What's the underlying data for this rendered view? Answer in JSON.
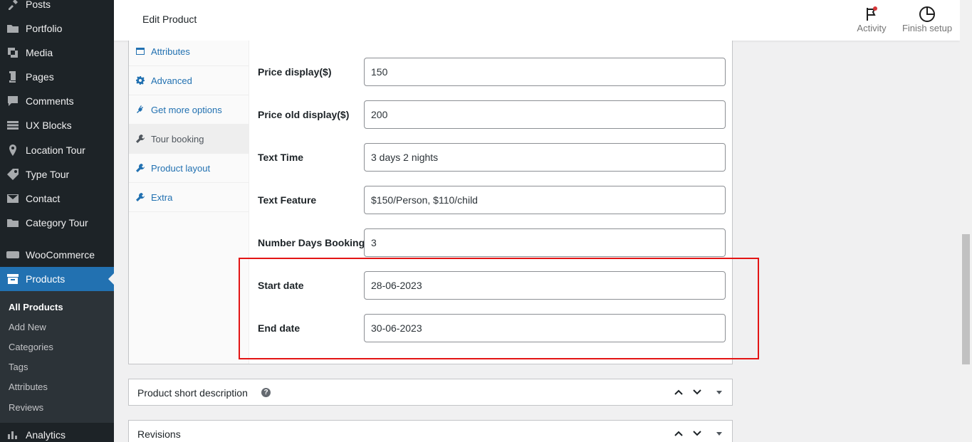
{
  "sidebar": {
    "items": [
      {
        "label": "Posts",
        "icon": "pin-icon"
      },
      {
        "label": "Portfolio",
        "icon": "folder-icon"
      },
      {
        "label": "Media",
        "icon": "media-icon"
      },
      {
        "label": "Pages",
        "icon": "pages-icon"
      },
      {
        "label": "Comments",
        "icon": "comment-icon"
      },
      {
        "label": "UX Blocks",
        "icon": "blocks-icon"
      },
      {
        "label": "Location Tour",
        "icon": "location-icon"
      },
      {
        "label": "Type Tour",
        "icon": "tag-icon"
      },
      {
        "label": "Contact",
        "icon": "mail-icon"
      },
      {
        "label": "Category Tour",
        "icon": "folder-icon"
      },
      {
        "label": "WooCommerce",
        "icon": "woo-icon"
      },
      {
        "label": "Products",
        "icon": "archive-icon"
      },
      {
        "label": "Analytics",
        "icon": "chart-icon"
      }
    ],
    "submenu": [
      "All Products",
      "Add New",
      "Categories",
      "Tags",
      "Attributes",
      "Reviews"
    ]
  },
  "header": {
    "title": "Edit Product",
    "activity_label": "Activity",
    "finish_setup_label": "Finish setup"
  },
  "product_tabs": [
    "Attributes",
    "Advanced",
    "Get more options",
    "Tour booking",
    "Product layout",
    "Extra"
  ],
  "fields": [
    {
      "label": "Price display($)",
      "value": "150"
    },
    {
      "label": "Price old display($)",
      "value": "200"
    },
    {
      "label": "Text Time",
      "value": "3 days 2 nights"
    },
    {
      "label": "Text Feature",
      "value": "$150/Person, $110/child"
    },
    {
      "label": "Number Days Booking",
      "value": "3"
    },
    {
      "label": "Start date",
      "value": "28-06-2023"
    },
    {
      "label": "End date",
      "value": "30-06-2023"
    }
  ],
  "metaboxes": {
    "short_description": "Product short description",
    "revisions": "Revisions"
  },
  "colors": {
    "accent": "#2271b1",
    "sidebar_bg": "#1d2327",
    "highlight": "#e31414"
  }
}
